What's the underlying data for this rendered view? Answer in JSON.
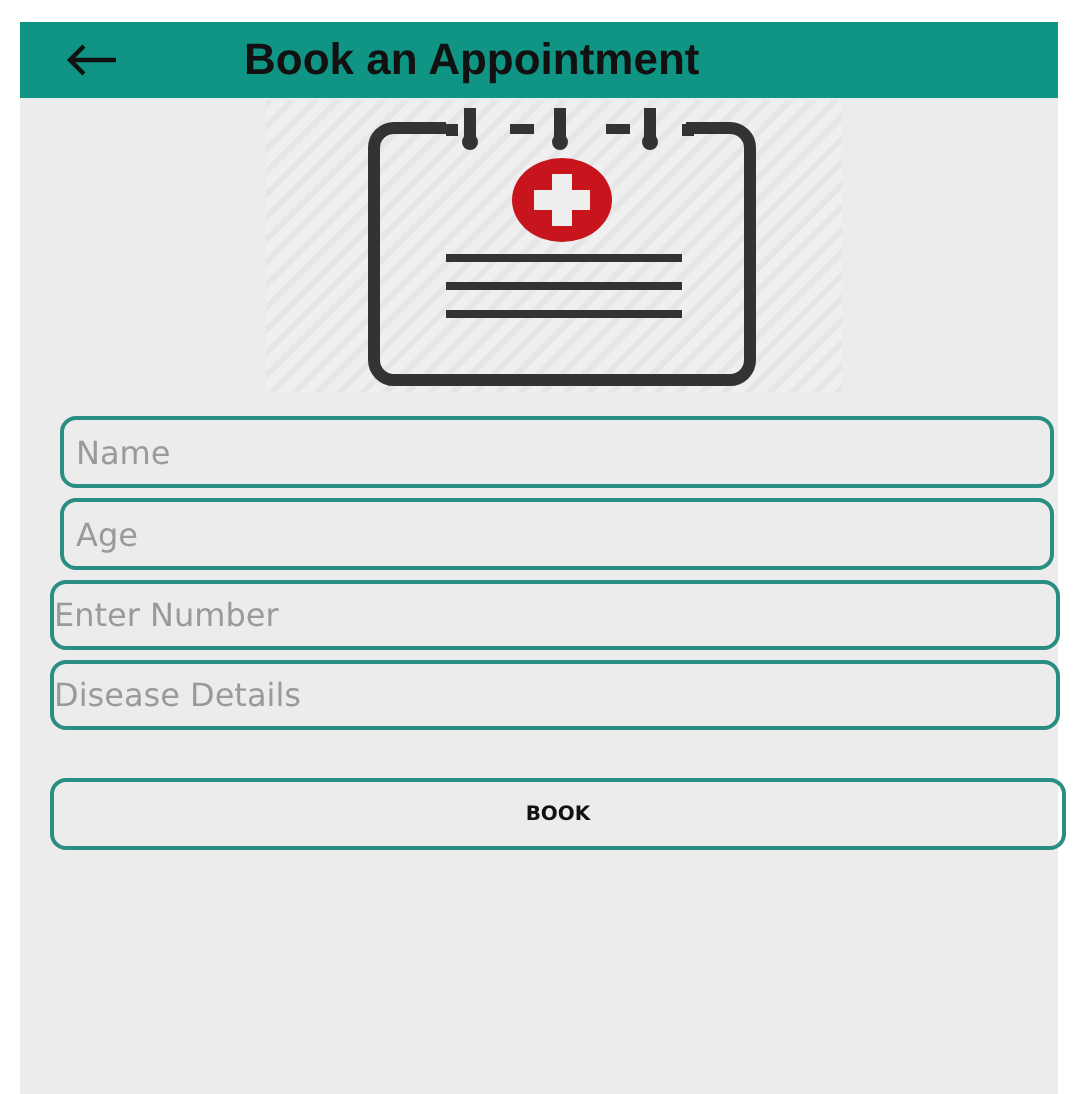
{
  "app_bar": {
    "title": "Book an Appointment"
  },
  "form": {
    "fields": [
      {
        "placeholder": "Name"
      },
      {
        "placeholder": "Age"
      },
      {
        "placeholder": "Enter Number"
      },
      {
        "placeholder": "Disease Details"
      }
    ],
    "button": "BOOK"
  }
}
